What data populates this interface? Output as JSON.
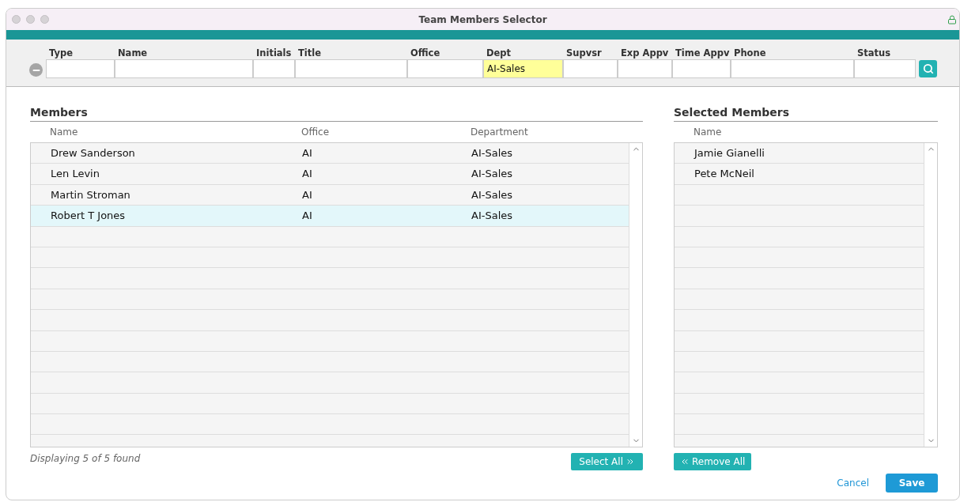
{
  "window": {
    "title": "Team Members Selector"
  },
  "filters": [
    {
      "label": "Type",
      "highlighted": false
    },
    {
      "label": "Name",
      "highlighted": false
    },
    {
      "label": "Initials",
      "highlighted": false
    },
    {
      "label": "Title",
      "highlighted": false
    },
    {
      "label": "Office",
      "highlighted": false
    },
    {
      "label": "Dept",
      "value": "AI-Sales",
      "highlighted": true
    },
    {
      "label": "Supvsr",
      "highlighted": false
    },
    {
      "label": "Exp Appv",
      "highlighted": false
    },
    {
      "label": "Time Appv",
      "highlighted": false
    },
    {
      "label": "Phone",
      "highlighted": false
    },
    {
      "label": "Status",
      "highlighted": false
    }
  ],
  "members": {
    "title": "Members",
    "columns": [
      "Name",
      "Office",
      "Department"
    ],
    "rows": [
      {
        "cells": [
          "Drew Sanderson",
          "AI",
          "AI-Sales"
        ],
        "selected": false
      },
      {
        "cells": [
          "Len Levin",
          "AI",
          "AI-Sales"
        ],
        "selected": false
      },
      {
        "cells": [
          "Martin Stroman",
          "AI",
          "AI-Sales"
        ],
        "selected": false
      },
      {
        "cells": [
          "Robert T Jones",
          "AI",
          "AI-Sales"
        ],
        "selected": true
      }
    ],
    "status": "Displaying 5 of 5 found",
    "button": "Select All"
  },
  "selected_members": {
    "title": "Selected Members",
    "columns": [
      "Name"
    ],
    "rows": [
      {
        "cells": [
          "Jamie Gianelli"
        ],
        "selected": false
      },
      {
        "cells": [
          "Pete McNeil"
        ],
        "selected": false
      }
    ],
    "button": "Remove All"
  },
  "buttons": {
    "cancel": "Cancel",
    "save": "Save"
  }
}
